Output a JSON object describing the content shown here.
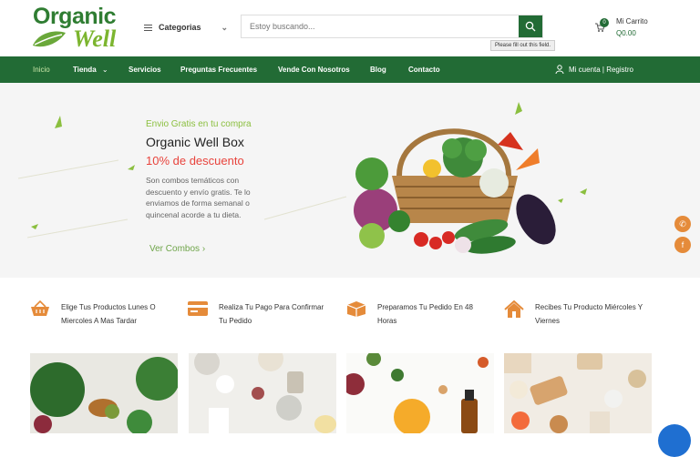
{
  "brand": {
    "line1": "Organic",
    "line2": "Well"
  },
  "header": {
    "categories_label": "Categorias",
    "search_placeholder": "Estoy buscando...",
    "tooltip": "Please fill out this field.",
    "cart_label": "Mi Carrito",
    "cart_total": "Q0.00",
    "cart_count": "0"
  },
  "nav": {
    "items": [
      "Inicio",
      "Tienda",
      "Servicios",
      "Preguntas Frecuentes",
      "Vende Con Nosotros",
      "Blog",
      "Contacto"
    ],
    "account": "Mi cuenta | Registro"
  },
  "hero": {
    "tagline": "Envio Gratis en tu compra",
    "title": "Organic Well Box",
    "discount": "10% de descuento",
    "desc": "Son combos temáticos con descuento y envío gratis. Te lo enviamos de forma semanal o quincenal acorde a tu dieta.",
    "cta": "Ver Combos"
  },
  "features": [
    {
      "icon": "basket-icon",
      "text": "Elige Tus Productos Lunes O Miercoles A Mas Tardar"
    },
    {
      "icon": "credit-card-icon",
      "text": "Realiza Tu Pago Para Confirmar Tu Pedido"
    },
    {
      "icon": "box-icon",
      "text": "Preparamos Tu Pedido En 48 Horas"
    },
    {
      "icon": "home-icon",
      "text": "Recibes Tu Producto Miércoles Y Viernes"
    }
  ],
  "colors": {
    "primary": "#226b35",
    "accent_green": "#8bbf3f",
    "discount_red": "#e8433c",
    "social_orange": "#e58b3a"
  }
}
